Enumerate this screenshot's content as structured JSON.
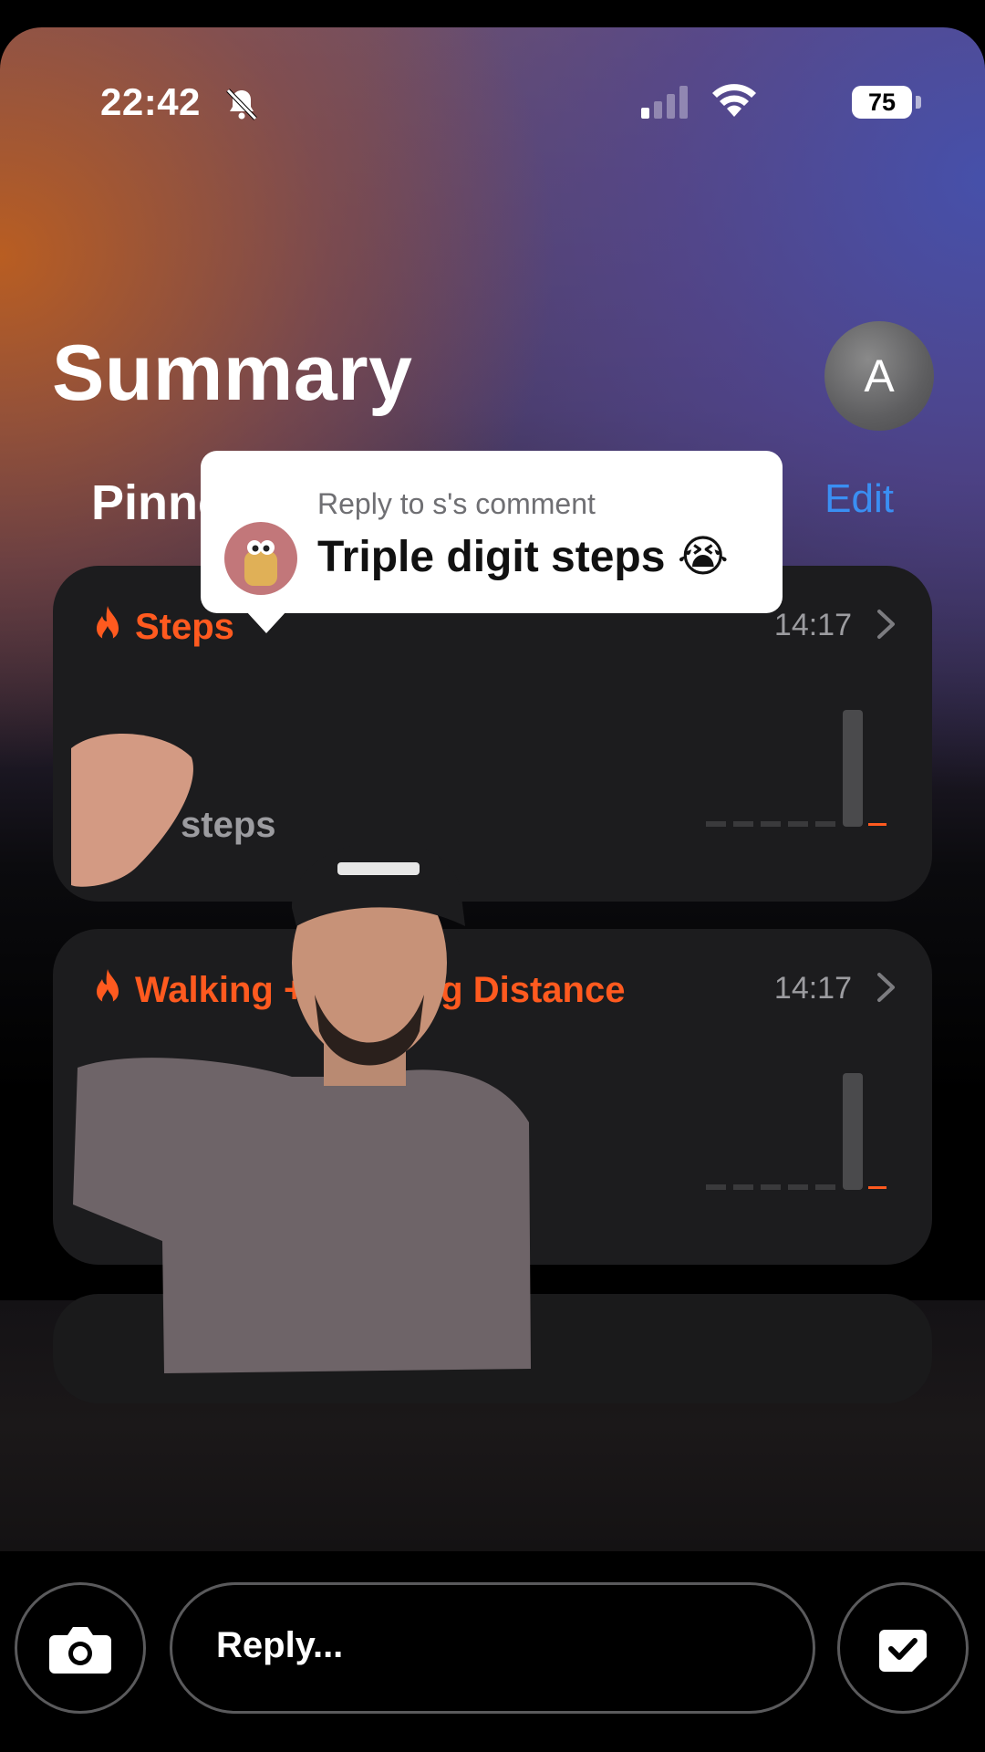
{
  "status_bar": {
    "time": "22:42",
    "battery": "75"
  },
  "header": {
    "title": "Summary",
    "avatar_initial": "A"
  },
  "section": {
    "label": "Pinned",
    "edit": "Edit"
  },
  "cards": [
    {
      "title": "Steps",
      "time": "14:17",
      "unit": "steps"
    },
    {
      "title": "Walking + Running Distance",
      "time": "14:17"
    }
  ],
  "comment_reply": {
    "subtitle": "Reply to s's comment",
    "text": "Triple digit steps 😭"
  },
  "reply_bar": {
    "placeholder": "Reply..."
  },
  "colors": {
    "accent_orange": "#ff5a1f",
    "edit_blue": "#3a8ff3",
    "card_bg": "#1c1c1e"
  },
  "icons": [
    "bell-slash-icon",
    "signal-icon",
    "wifi-icon",
    "battery-icon",
    "flame-icon",
    "chevron-right-icon",
    "camera-icon",
    "sticker-icon"
  ]
}
